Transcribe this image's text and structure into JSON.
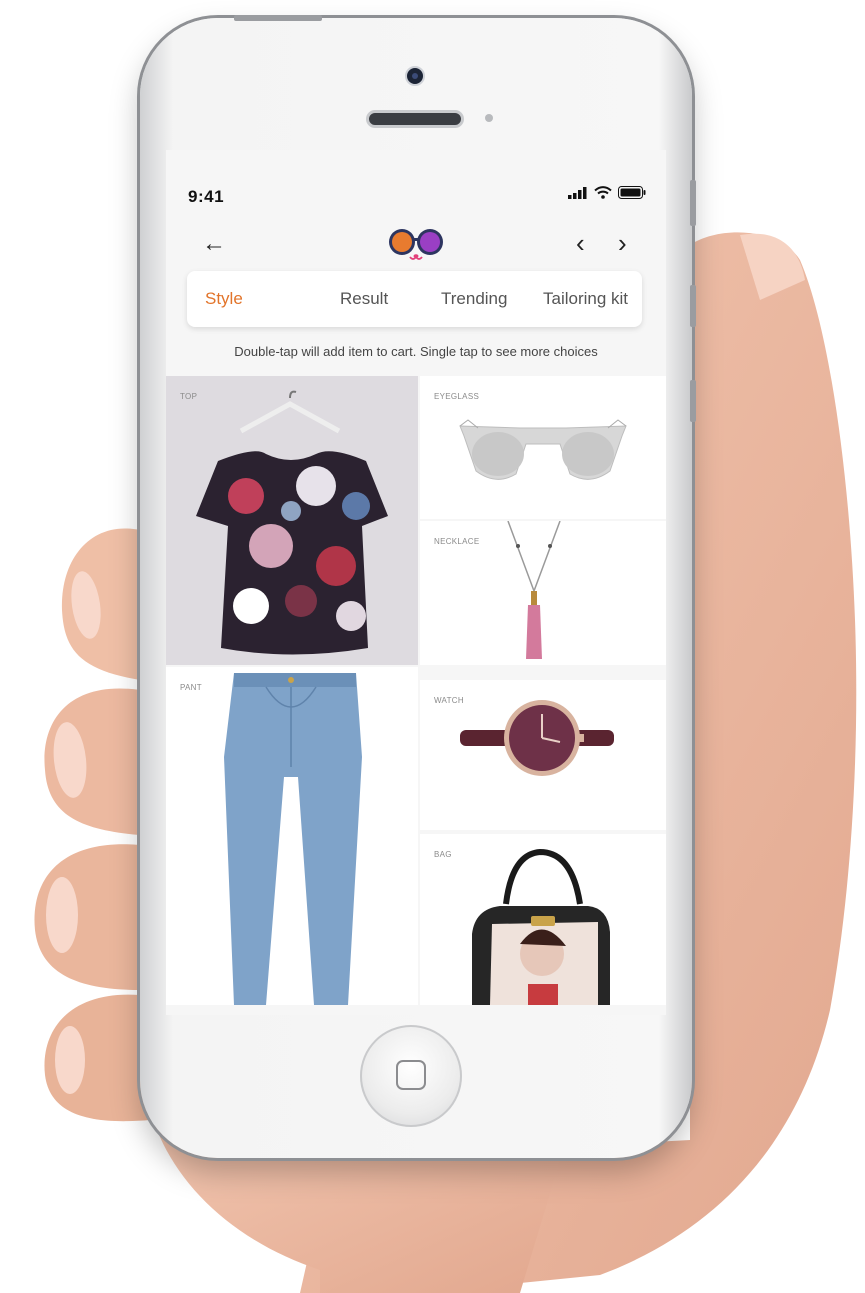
{
  "status_bar": {
    "time": "9:41"
  },
  "tabs": [
    "Style",
    "Result",
    "Trending",
    "Tailoring kit"
  ],
  "active_tab": "Style",
  "hint": "Double-tap will add item to cart. Single tap to see more choices",
  "items": {
    "top": "TOP",
    "eyeglass": "EYEGLASS",
    "necklace": "NECKLACE",
    "pant": "PANT",
    "watch": "WATCH",
    "bag": "BAG"
  },
  "colors": {
    "accent": "#e2742a",
    "screen_bg": "#f6f6f6"
  },
  "icons": [
    "back-arrow-icon",
    "prev-chevron-icon",
    "next-chevron-icon",
    "signal-icon",
    "wifi-icon",
    "battery-icon",
    "sunglasses-logo",
    "home-square-icon"
  ]
}
